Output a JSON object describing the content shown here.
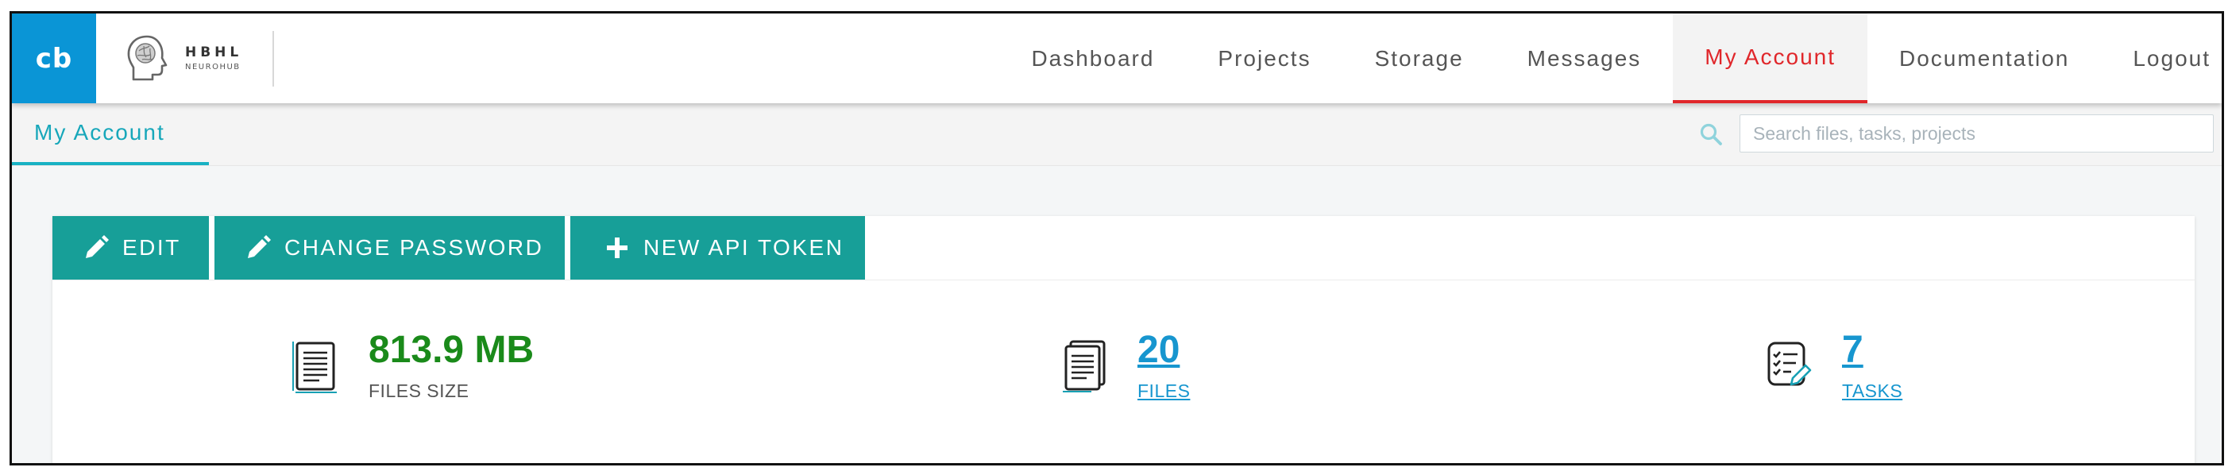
{
  "header": {
    "logo_text": "cb",
    "brand_name": "HBHL",
    "brand_sub": "NEUROHUB",
    "nav": [
      {
        "label": "Dashboard"
      },
      {
        "label": "Projects"
      },
      {
        "label": "Storage"
      },
      {
        "label": "Messages"
      },
      {
        "label": "My Account",
        "active": true
      },
      {
        "label": "Documentation"
      },
      {
        "label": "Logout"
      }
    ]
  },
  "subnav": {
    "tab_label": "My Account",
    "search_placeholder": "Search files, tasks, projects",
    "search_value": ""
  },
  "actions": {
    "edit_label": "EDIT",
    "change_password_label": "CHANGE PASSWORD",
    "new_api_token_label": "NEW API TOKEN"
  },
  "stats": {
    "files_size_value": "813.9 MB",
    "files_size_label": "FILES SIZE",
    "files_value": "20",
    "files_label": "FILES",
    "tasks_value": "7",
    "tasks_label": "TASKS"
  },
  "icons": {
    "search": "search-icon",
    "edit": "pencil-icon",
    "change_password": "pencil-icon",
    "new_api_token": "plus-icon",
    "files_size": "document-icon",
    "files": "documents-stack-icon",
    "tasks": "checklist-icon"
  },
  "colors": {
    "logo_bg": "#0a95d6",
    "active_nav": "#e0262a",
    "tab_accent": "#19b1c3",
    "button_bg": "#179f98",
    "size_value": "#1a8a1a",
    "link": "#1796cf"
  }
}
